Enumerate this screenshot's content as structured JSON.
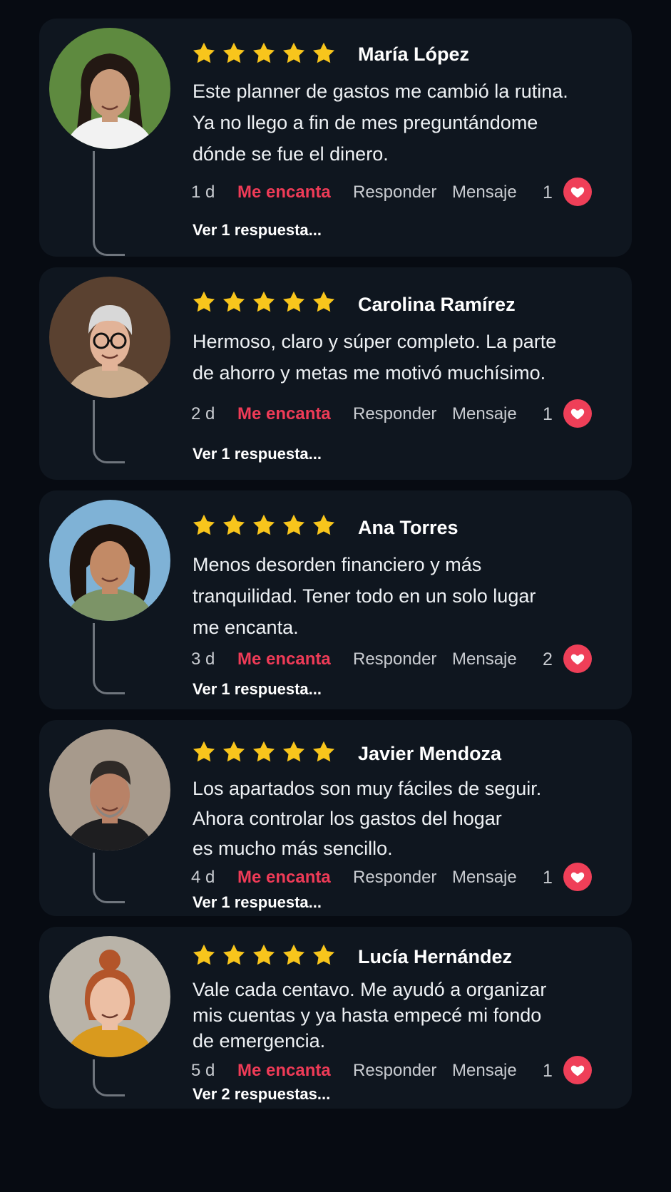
{
  "reviews": [
    {
      "name": "María López",
      "rating": 5,
      "text_lines": [
        "Este planner de gastos me cambió la rutina.",
        "Ya no llego a fin de mes preguntándome",
        "dónde se fue el dinero."
      ],
      "time": "1 d",
      "love_label": "Me encanta",
      "reply_label": "Responder",
      "message_label": "Mensaje",
      "likes": "1",
      "view_replies": "Ver 1 respuesta...",
      "avatar_colors": {
        "bg": "#5e8a3f",
        "skin": "#c99a7a",
        "hair": "#231813",
        "clothes": "#f2f2f2"
      }
    },
    {
      "name": "Carolina Ramírez",
      "rating": 5,
      "text_lines": [
        "Hermoso, claro y súper completo. La parte",
        "de ahorro y metas me motivó muchísimo."
      ],
      "time": "2 d",
      "love_label": "Me encanta",
      "reply_label": "Responder",
      "message_label": "Mensaje",
      "likes": "1",
      "view_replies": "Ver 1 respuesta...",
      "avatar_colors": {
        "bg": "#5a4130",
        "skin": "#e2b398",
        "hair": "#d8d8d8",
        "clothes": "#c9ab8c"
      }
    },
    {
      "name": "Ana Torres",
      "rating": 5,
      "text_lines": [
        "Menos desorden financiero y más",
        "tranquilidad. Tener todo en un solo lugar",
        "me encanta."
      ],
      "time": "3 d",
      "love_label": "Me encanta",
      "reply_label": "Responder",
      "message_label": "Mensaje",
      "likes": "2",
      "view_replies": "Ver 1 respuesta...",
      "avatar_colors": {
        "bg": "#7fb2d6",
        "skin": "#c28a66",
        "hair": "#1d130e",
        "clothes": "#7c9467"
      }
    },
    {
      "name": "Javier Mendoza",
      "rating": 5,
      "text_lines": [
        "Los apartados son muy fáciles de seguir.",
        "Ahora controlar los gastos del hogar",
        "es mucho más sencillo."
      ],
      "time": "4 d",
      "love_label": "Me encanta",
      "reply_label": "Responder",
      "message_label": "Mensaje",
      "likes": "1",
      "view_replies": "Ver 1 respuesta...",
      "avatar_colors": {
        "bg": "#a79a8c",
        "skin": "#b88267",
        "hair": "#2f2a27",
        "clothes": "#1e1e20"
      }
    },
    {
      "name": "Lucía Hernández",
      "rating": 5,
      "text_lines": [
        "Vale cada centavo. Me ayudó a organizar",
        "mis cuentas y ya hasta empecé mi fondo",
        "de emergencia."
      ],
      "time": "5 d",
      "love_label": "Me encanta",
      "reply_label": "Responder",
      "message_label": "Mensaje",
      "likes": "1",
      "view_replies": "Ver 2 respuestas...",
      "avatar_colors": {
        "bg": "#b9b3a8",
        "skin": "#ecbfa4",
        "hair": "#b3552a",
        "clothes": "#d99a1e"
      }
    }
  ],
  "colors": {
    "page_bg": "#070b12",
    "card_bg": "#0f161f",
    "star": "#f8c51c",
    "accent": "#ef3b57",
    "heart_bg": "#ef3f58"
  },
  "icons": {
    "star": "star-icon",
    "heart": "heart-icon"
  }
}
